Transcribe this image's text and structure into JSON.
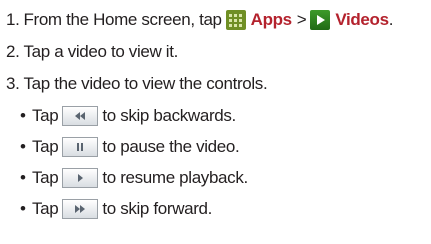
{
  "steps": [
    {
      "number": "1.",
      "text_before": "From the Home screen, tap",
      "apps_label": "Apps",
      "separator": ">",
      "videos_label": "Videos",
      "end": "."
    },
    {
      "number": "2.",
      "text": "Tap a video to view it."
    },
    {
      "number": "3.",
      "text": "Tap the video to view the controls."
    }
  ],
  "bullets": [
    {
      "tap": "Tap",
      "icon": "rewind-icon",
      "text": "to skip backwards."
    },
    {
      "tap": "Tap",
      "icon": "pause-icon",
      "text": "to pause the video."
    },
    {
      "tap": "Tap",
      "icon": "play-icon",
      "text": "to resume playback."
    },
    {
      "tap": "Tap",
      "icon": "fast-forward-icon",
      "text": "to skip forward."
    }
  ],
  "bullet_char": "•",
  "colors": {
    "text": "#231f20",
    "accent": "#b4222d",
    "apps_icon": "#6f8f24",
    "videos_icon": "#2e8a22"
  }
}
